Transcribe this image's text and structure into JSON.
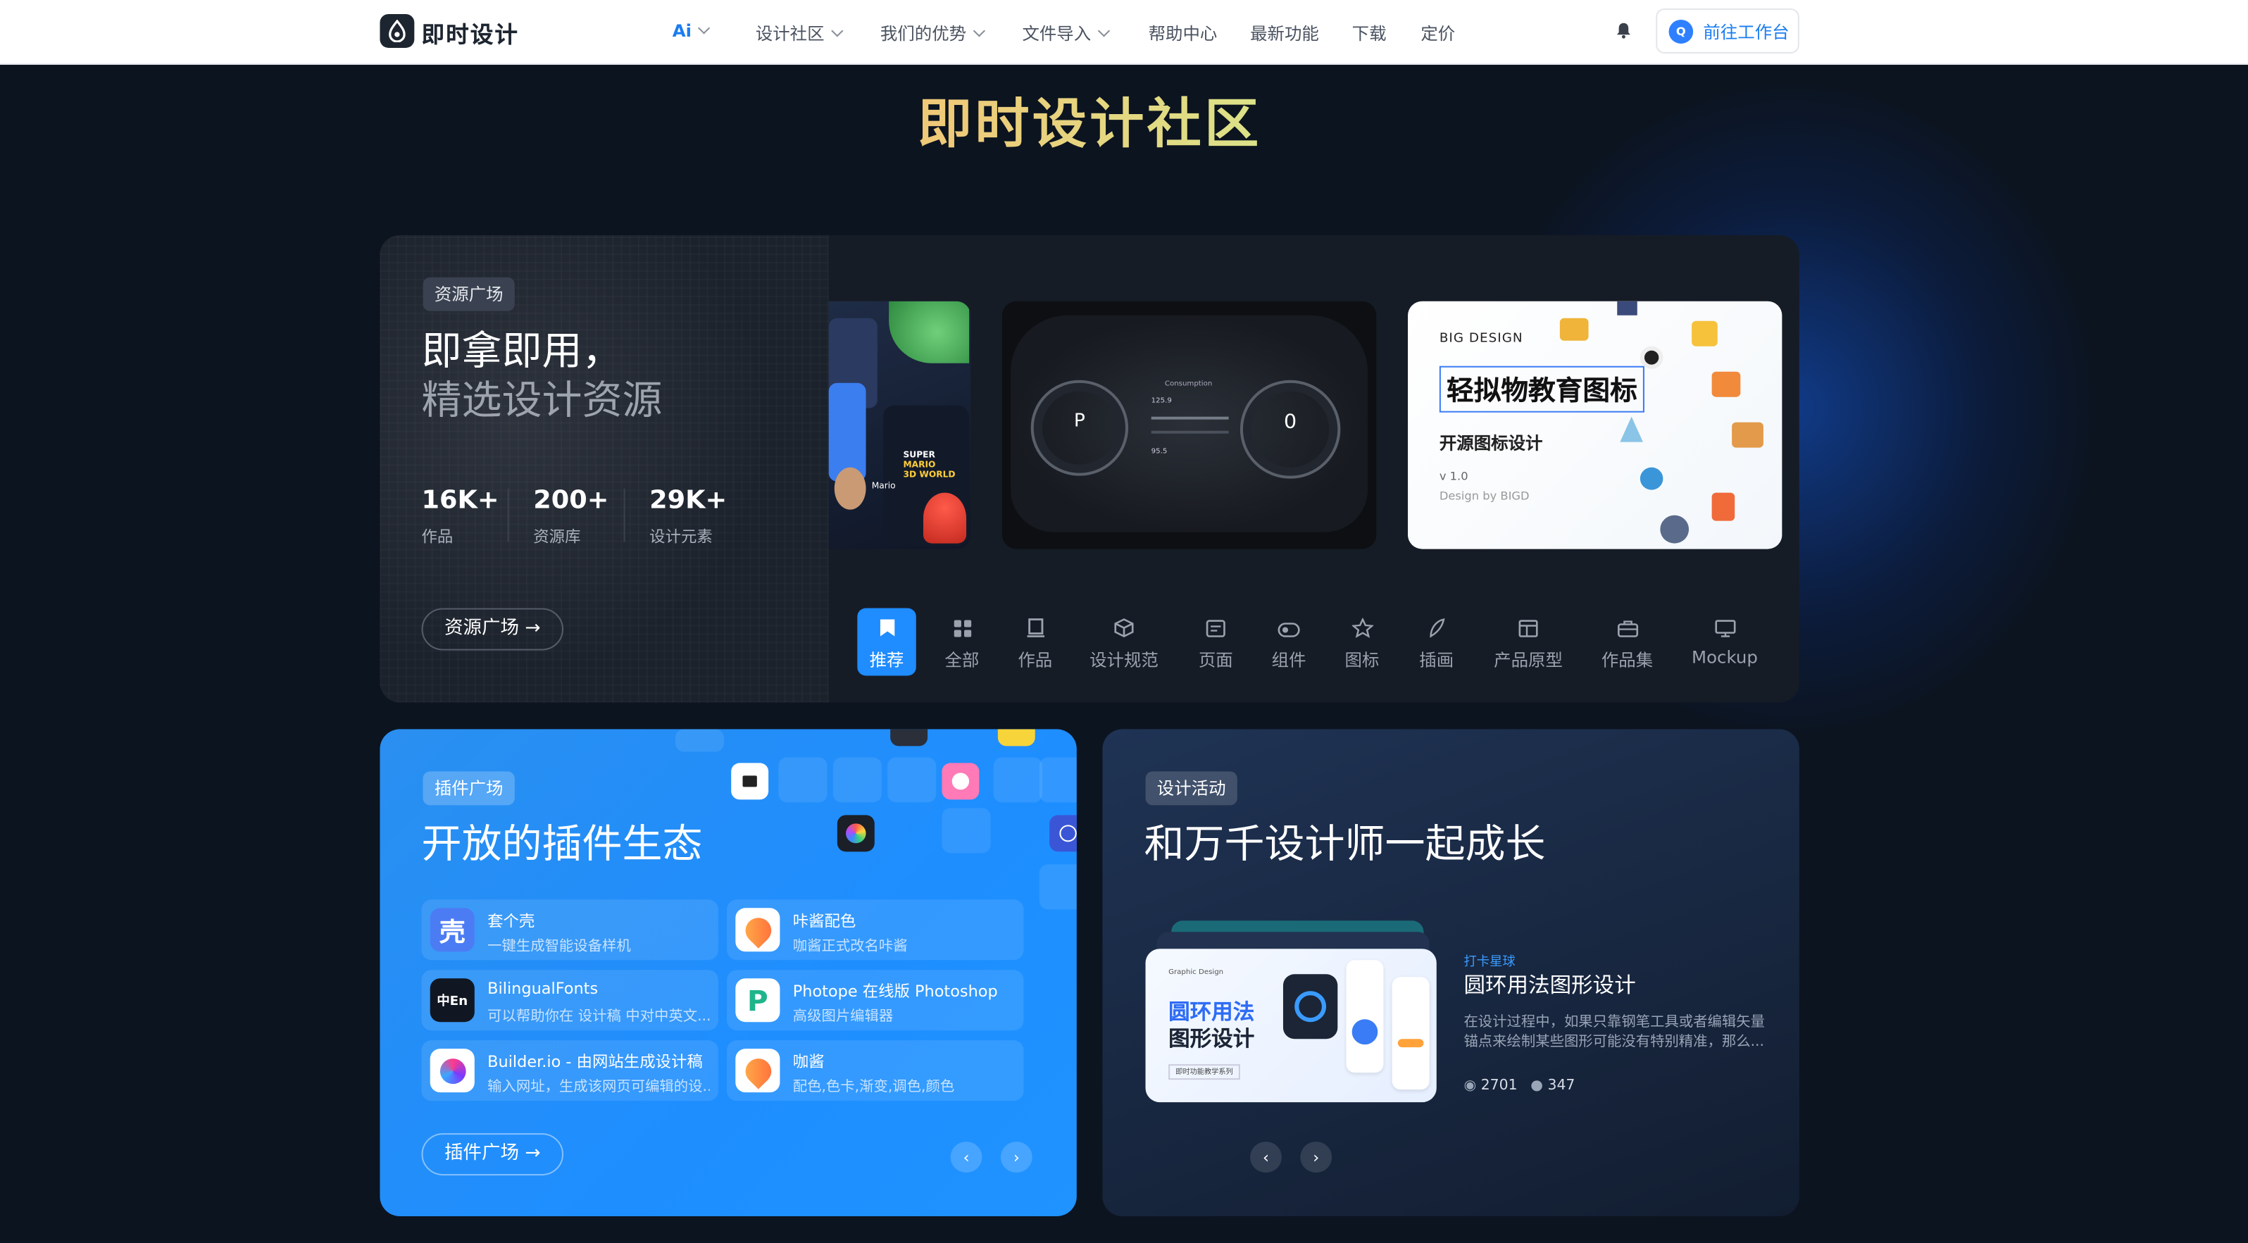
{
  "nav": {
    "logo": "即时设计",
    "links": [
      {
        "label": "Ai",
        "dropdown": true
      },
      {
        "label": "设计社区",
        "dropdown": true
      },
      {
        "label": "我们的优势",
        "dropdown": true
      },
      {
        "label": "文件导入",
        "dropdown": true
      },
      {
        "label": "帮助中心",
        "dropdown": false
      },
      {
        "label": "最新功能",
        "dropdown": false
      },
      {
        "label": "下载",
        "dropdown": false
      },
      {
        "label": "定价",
        "dropdown": false
      }
    ],
    "avatar_letter": "Q",
    "workspace_button": "前往工作台"
  },
  "hero": {
    "title": "即时设计社区"
  },
  "resources": {
    "tag": "资源广场",
    "headline_1": "即拿即用，",
    "headline_2": "精选设计资源",
    "stats": [
      {
        "value": "16K+",
        "label": "作品"
      },
      {
        "value": "200+",
        "label": "资源库"
      },
      {
        "value": "29K+",
        "label": "设计元素"
      }
    ],
    "button": "资源广场",
    "thumb_mario": {
      "super": "SUPER",
      "title": "MARIO",
      "sub": "3D WORLD",
      "name": "Mario"
    },
    "thumb_dash": {
      "p": "P",
      "zero": "0",
      "consumption": "Consumption",
      "val1": "125.9",
      "val2": "95.5"
    },
    "thumb_edu": {
      "brand": "BIG DESIGN",
      "title": "轻拟物教育图标",
      "subtitle": "开源图标设计",
      "version": "v 1.0",
      "by": "Design by BIGD"
    },
    "categories": [
      {
        "label": "推荐",
        "icon": "bookmark-icon",
        "active": true
      },
      {
        "label": "全部",
        "icon": "grid-icon",
        "active": false
      },
      {
        "label": "作品",
        "icon": "document-icon",
        "active": false
      },
      {
        "label": "设计规范",
        "icon": "cube-icon",
        "active": false
      },
      {
        "label": "页面",
        "icon": "page-icon",
        "active": false
      },
      {
        "label": "组件",
        "icon": "toggle-icon",
        "active": false
      },
      {
        "label": "图标",
        "icon": "star-icon",
        "active": false
      },
      {
        "label": "插画",
        "icon": "feather-icon",
        "active": false
      },
      {
        "label": "产品原型",
        "icon": "layout-icon",
        "active": false
      },
      {
        "label": "作品集",
        "icon": "briefcase-icon",
        "active": false
      },
      {
        "label": "Mockup",
        "icon": "monitor-icon",
        "active": false
      }
    ]
  },
  "plugins": {
    "tag": "插件广场",
    "headline": "开放的插件生态",
    "items": [
      {
        "icon_text": "壳",
        "icon_bg": "#4c7cf3",
        "title": "套个壳",
        "subtitle": "一键生成智能设备样机"
      },
      {
        "icon_text": "",
        "icon_bg": "#ffffff",
        "title": "咔酱配色",
        "subtitle": "咖酱正式改名咔酱"
      },
      {
        "icon_text": "中En",
        "icon_bg": "#111722",
        "title": "BilingualFonts",
        "subtitle": "可以帮助你在 设计稿 中对中英文..."
      },
      {
        "icon_text": "P",
        "icon_bg": "#ffffff",
        "title": "Photope 在线版 Photoshop",
        "subtitle": "高级图片编辑器"
      },
      {
        "icon_text": "",
        "icon_bg": "#ffffff",
        "title": "Builder.io - 由网站生成设计稿",
        "subtitle": "输入网址，生成该网页可编辑的设..."
      },
      {
        "icon_text": "",
        "icon_bg": "#ffffff",
        "title": "咖酱",
        "subtitle": "配色,色卡,渐变,调色,颜色"
      }
    ],
    "button": "插件广场",
    "prev": "‹",
    "next": "›"
  },
  "events": {
    "tag": "设计活动",
    "headline": "和万千设计师一起成长",
    "card": {
      "kicker": "打卡星球",
      "title": "圆环用法图形设计",
      "desc_1": "在设计过程中，如果只靠钢笔工具或者编辑矢量",
      "desc_2": "锚点来绘制某些图形可能没有特别精准，那么...",
      "views": "2701",
      "users": "347",
      "thumb_small": "Graphic Design",
      "thumb_title_1": "圆环用法",
      "thumb_title_2": "图形设计",
      "thumb_footer": "即时功能教学系列"
    },
    "prev": "‹",
    "next": "›"
  },
  "colors": {
    "accent": "#1f8cff",
    "page_bg": "#0c1420",
    "plugin_card": "#1e8eff"
  }
}
